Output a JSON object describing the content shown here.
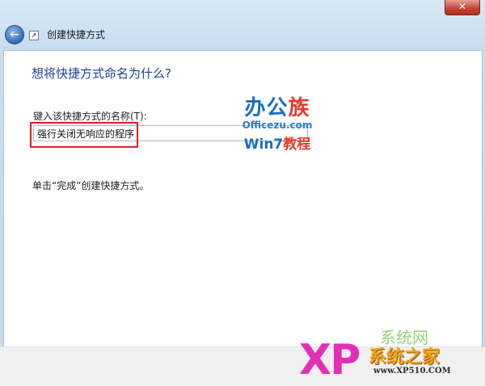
{
  "window": {
    "title": "创建快捷方式",
    "close_glyph": "✕",
    "back_glyph": "←"
  },
  "content": {
    "heading": "想将快捷方式命名为什么?",
    "field_label": "键入该快捷方式的名称(T):",
    "name_value": "强行关闭无响应的程序",
    "instruction": "单击“完成”创建快捷方式。"
  },
  "watermark_top": {
    "logo_main": "办公",
    "logo_accent": "族",
    "site": "Officezu.com",
    "sub_main": "Win7",
    "sub_accent": "教程"
  },
  "watermark_bottom": {
    "xp": "XP",
    "line1": "系统网",
    "line2": "系统之家",
    "line3": "www.XP510.COM"
  },
  "colors": {
    "heading": "#1e3f8b",
    "highlight_box": "#d9201f",
    "close_button": "#c7463a"
  }
}
